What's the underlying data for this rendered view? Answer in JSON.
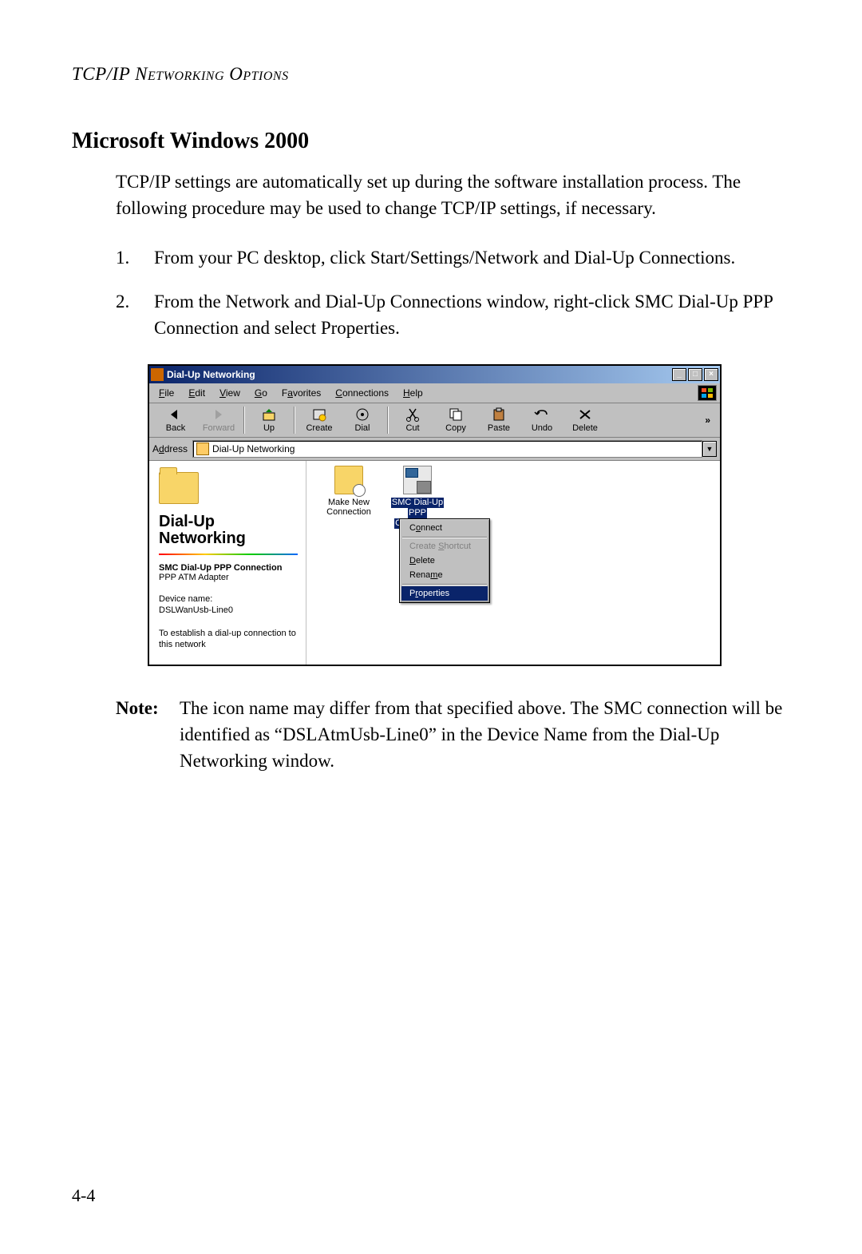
{
  "header": "TCP/IP Networking Options",
  "section_title": "Microsoft Windows 2000",
  "intro": "TCP/IP settings are automatically set up during the software installation process. The following procedure may be used to change TCP/IP settings, if necessary.",
  "steps": [
    "From your PC desktop, click Start/Settings/Network and Dial-Up Connections.",
    "From the Network and Dial-Up Connections window, right-click SMC Dial-Up PPP Connection and select Properties."
  ],
  "note_label": "Note:",
  "note_text": "The icon name may differ from that specified above. The SMC connection will be identified as “DSLAtmUsb-Line0” in the Device Name from the Dial-Up Networking window.",
  "page_number": "4-4",
  "window": {
    "title": "Dial-Up Networking",
    "menu": [
      "File",
      "Edit",
      "View",
      "Go",
      "Favorites",
      "Connections",
      "Help"
    ],
    "toolbar": [
      {
        "label": "Back",
        "disabled": false
      },
      {
        "label": "Forward",
        "disabled": true
      },
      {
        "label": "Up",
        "disabled": false
      },
      {
        "label": "Create",
        "disabled": false
      },
      {
        "label": "Dial",
        "disabled": false
      },
      {
        "label": "Cut",
        "disabled": false
      },
      {
        "label": "Copy",
        "disabled": false
      },
      {
        "label": "Paste",
        "disabled": false
      },
      {
        "label": "Undo",
        "disabled": false
      },
      {
        "label": "Delete",
        "disabled": false
      }
    ],
    "address_label": "Address",
    "address_value": "Dial-Up Networking",
    "left": {
      "title_line1": "Dial-Up",
      "title_line2": "Networking",
      "selected_name": "SMC Dial-Up PPP Connection",
      "selected_sub": "PPP ATM Adapter",
      "device_label": "Device name:",
      "device_value": "DSLWanUsb-Line0",
      "hint": "To establish a dial-up connection to this network"
    },
    "icons": {
      "make_new": "Make New Connection",
      "smc_line1": "SMC Dial-Up",
      "smc_line2": "PPP",
      "smc_line3": "Connection"
    },
    "context_menu": {
      "connect": "Connect",
      "create_shortcut": "Create Shortcut",
      "delete": "Delete",
      "rename": "Rename",
      "properties": "Properties"
    }
  }
}
